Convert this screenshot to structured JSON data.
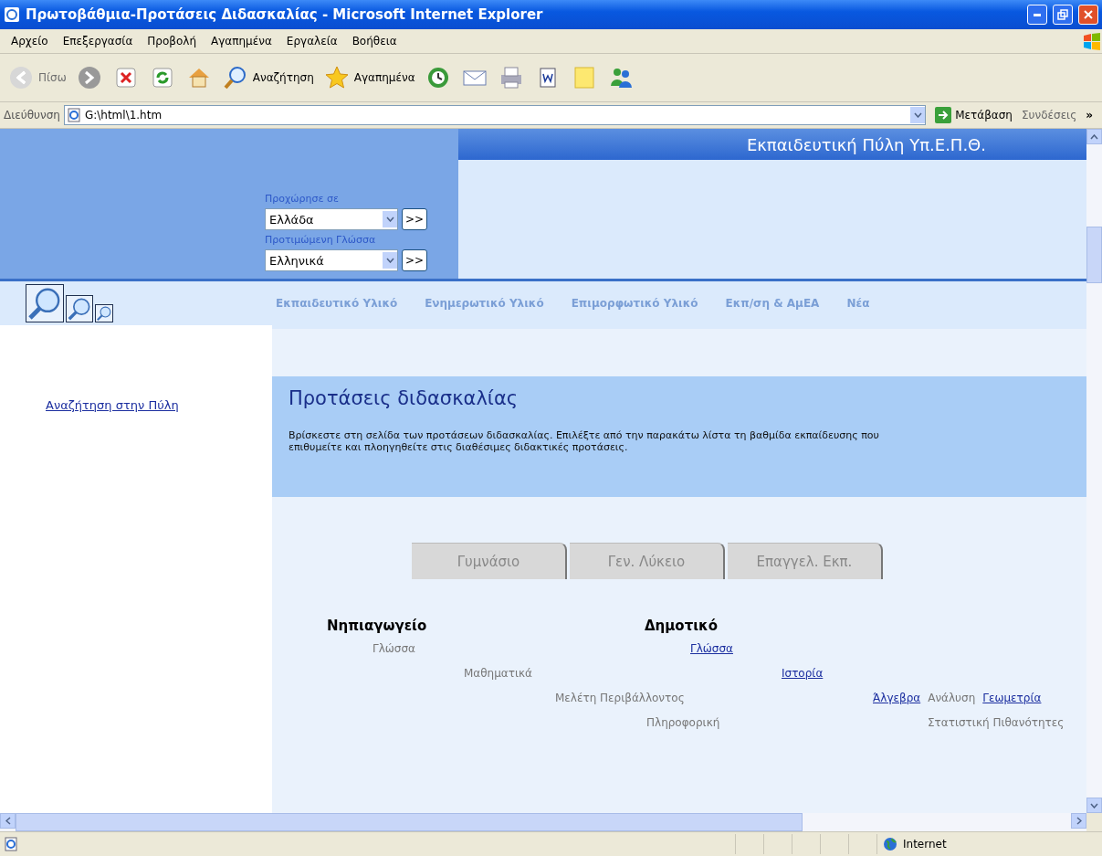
{
  "window": {
    "title": "Πρωτοβάθμια-Προτάσεις Διδασκαλίας - Microsoft Internet Explorer"
  },
  "menu": [
    "Αρχείο",
    "Επεξεργασία",
    "Προβολή",
    "Αγαπημένα",
    "Εργαλεία",
    "Βοήθεια"
  ],
  "toolbar": [
    {
      "kind": "back",
      "label": "Πίσω",
      "disabled": true
    },
    {
      "kind": "forward",
      "disabled": false
    },
    {
      "kind": "stop"
    },
    {
      "kind": "refresh"
    },
    {
      "kind": "home"
    },
    {
      "kind": "search",
      "label": "Αναζήτηση"
    },
    {
      "kind": "favorites",
      "label": "Αγαπημένα"
    },
    {
      "kind": "history"
    },
    {
      "kind": "mail"
    },
    {
      "kind": "print"
    },
    {
      "kind": "word"
    },
    {
      "kind": "note"
    },
    {
      "kind": "messenger"
    }
  ],
  "address_bar": {
    "label": "Διεύθυνση",
    "value": "G:\\html\\1.htm",
    "go": "Μετάβαση",
    "links": "Συνδέσεις",
    "more": "»"
  },
  "header": {
    "portal_title": "Εκπαιδευτική Πύλη Υπ.Ε.Π.Θ.",
    "selectors": [
      {
        "label": "Προχώρησε σε",
        "value": "Ελλάδα",
        "button": ">>"
      },
      {
        "label": "Προτιμώμενη Γλώσσα",
        "value": "Ελληνικά",
        "button": ">>"
      }
    ]
  },
  "nav": [
    "Εκπαιδευτικό Υλικό",
    "Ενημερωτικό Υλικό",
    "Επιμορφωτικό Υλικό",
    "Εκπ/ση & ΑμΕΑ",
    "Νέα"
  ],
  "sidebar": {
    "link": "Αναζήτηση στην Πύλη"
  },
  "intro": {
    "heading": "Προτάσεις διδασκαλίας",
    "text": "Βρίσκεστε στη σελίδα των προτάσεων διδασκαλίας. Επιλέξτε από την παρακάτω λίστα τη βαθμίδα εκπαίδευσης που επιθυμείτε και πλοηγηθείτε στις διαθέσιμες διδακτικές προτάσεις."
  },
  "tabs": [
    {
      "label": "Γυμνάσιο",
      "selected": false
    },
    {
      "label": "Γεν. Λύκειο",
      "selected": false
    },
    {
      "label": "Επαγγελ. Εκπ.",
      "selected": false
    }
  ],
  "levels": [
    {
      "title": "Νηπιαγωγείο",
      "lines": [
        {
          "entries": [
            {
              "text": "Γλώσσα",
              "link": false
            }
          ]
        },
        {
          "entries": [
            {
              "text": "Μαθηματικά",
              "link": false
            }
          ]
        },
        {
          "entries": [
            {
              "text": "Μελέτη Περιβάλλοντος",
              "link": false
            }
          ]
        },
        {
          "entries": [
            {
              "text": "Πληροφορική",
              "link": false
            }
          ]
        }
      ]
    },
    {
      "title": "Δημοτικό",
      "lines": [
        {
          "entries": [
            {
              "text": "Γλώσσα",
              "link": true
            }
          ]
        },
        {
          "entries": [
            {
              "text": "Ιστορία",
              "link": true
            }
          ]
        },
        {
          "entries": [
            {
              "text": "Άλγεβρα",
              "link": true
            },
            {
              "text": "Ανάλυση",
              "link": false
            },
            {
              "text": "Γεωμετρία",
              "link": true
            }
          ]
        },
        {
          "entries": [
            {
              "text": "Στατιστική Πιθανότητες",
              "link": false
            }
          ]
        }
      ]
    }
  ],
  "status_bar": {
    "zone": "Internet"
  }
}
